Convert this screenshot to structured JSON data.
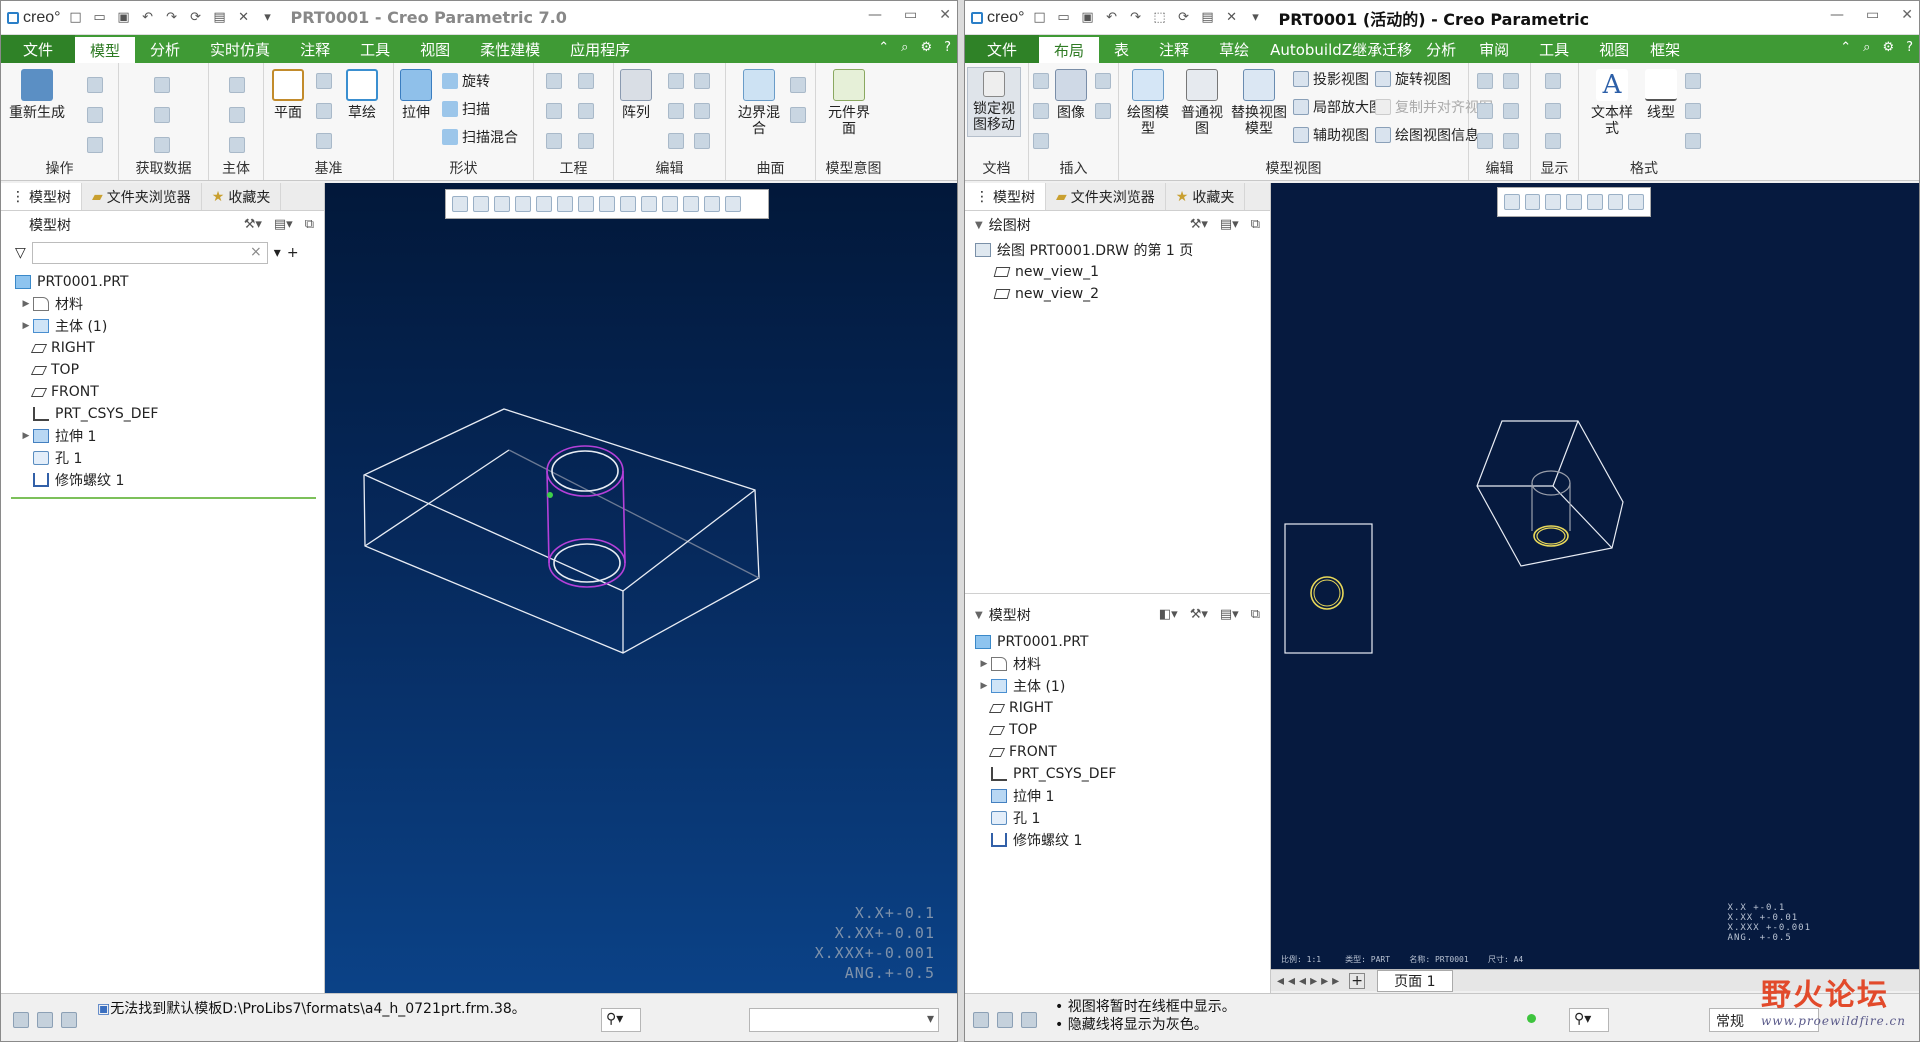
{
  "left": {
    "app_title": "PRT0001 - Creo Parametric 7.0",
    "logo": "creo°",
    "tabs": [
      "文件",
      "模型",
      "分析",
      "实时仿真",
      "注释",
      "工具",
      "视图",
      "柔性建模",
      "应用程序"
    ],
    "ribbon": {
      "regen": "重新生成",
      "plane": "平面",
      "sketch": "草绘",
      "extrude": "拉伸",
      "revolve": "旋转",
      "sweep": "扫描",
      "blend": "扫描混合",
      "pattern": "阵列",
      "boundary": "边界混合",
      "component": "元件界面",
      "groups": [
        "操作",
        "获取数据",
        "主体",
        "基准",
        "形状",
        "工程",
        "编辑",
        "曲面",
        "模型意图"
      ]
    },
    "panel_tabs": [
      "模型树",
      "文件夹浏览器",
      "收藏夹"
    ],
    "tree_header": "模型树",
    "tree": [
      "PRT0001.PRT",
      "材料",
      "主体 (1)",
      "RIGHT",
      "TOP",
      "FRONT",
      "PRT_CSYS_DEF",
      "拉伸 1",
      "孔 1",
      "修饰螺纹 1"
    ],
    "tolerance": [
      "X.X+-0.1",
      "X.XX+-0.01",
      "X.XXX+-0.001",
      "ANG.+-0.5"
    ],
    "status_message": "无法找到默认模板D:\\ProLibs7\\formats\\a4_h_0721prt.frm.38。"
  },
  "right": {
    "app_title": "PRT0001 (活动的) - Creo Parametric",
    "logo": "creo°",
    "tabs": [
      "文件",
      "布局",
      "表",
      "注释",
      "草绘",
      "AutobuildZ继承迁移",
      "分析",
      "审阅",
      "工具",
      "视图",
      "框架"
    ],
    "ribbon": {
      "lock_view": "锁定视图移动",
      "image": "图像",
      "draw_model": "绘图模型",
      "general_view": "普通视图",
      "replace_view": "替换视图模型",
      "projection": "投影视图",
      "detail": "局部放大图",
      "auxiliary": "辅助视图",
      "revolved": "旋转视图",
      "copy_align": "复制并对齐视图",
      "view_info": "绘图视图信息",
      "text_style": "文本样式",
      "line_style": "线型",
      "groups": [
        "文档",
        "插入",
        "模型视图",
        "编辑",
        "显示",
        "格式"
      ]
    },
    "panel_tabs": [
      "模型树",
      "文件夹浏览器",
      "收藏夹"
    ],
    "drawing_tree_header": "绘图树",
    "drawing_tree": [
      "绘图 PRT0001.DRW 的第 1 页",
      "new_view_1",
      "new_view_2"
    ],
    "tree_header": "模型树",
    "tree": [
      "PRT0001.PRT",
      "材料",
      "主体 (1)",
      "RIGHT",
      "TOP",
      "FRONT",
      "PRT_CSYS_DEF",
      "拉伸 1",
      "孔 1",
      "修饰螺纹 1"
    ],
    "tolerance": [
      "X.X  +-0.1",
      "X.XX +-0.01",
      "X.XXX +-0.001",
      "ANG.  +-0.5"
    ],
    "sheet_info": "比例: 1:1     类型: PART    名称: PRT0001    尺寸: A4",
    "page_label": "页面 1",
    "status_messages": [
      "• 视图将暂时在线框中显示。",
      "• 隐藏线将显示为灰色。"
    ],
    "mode_combo": "常规"
  },
  "watermark": {
    "title": "野火论坛",
    "url": "www.proewildfire.cn"
  },
  "colors": {
    "ribbon_green": "#3f9a35",
    "viewport_top": "#02183a",
    "viewport_bottom": "#0a3f80",
    "drawing_bg": "#061a3f"
  }
}
